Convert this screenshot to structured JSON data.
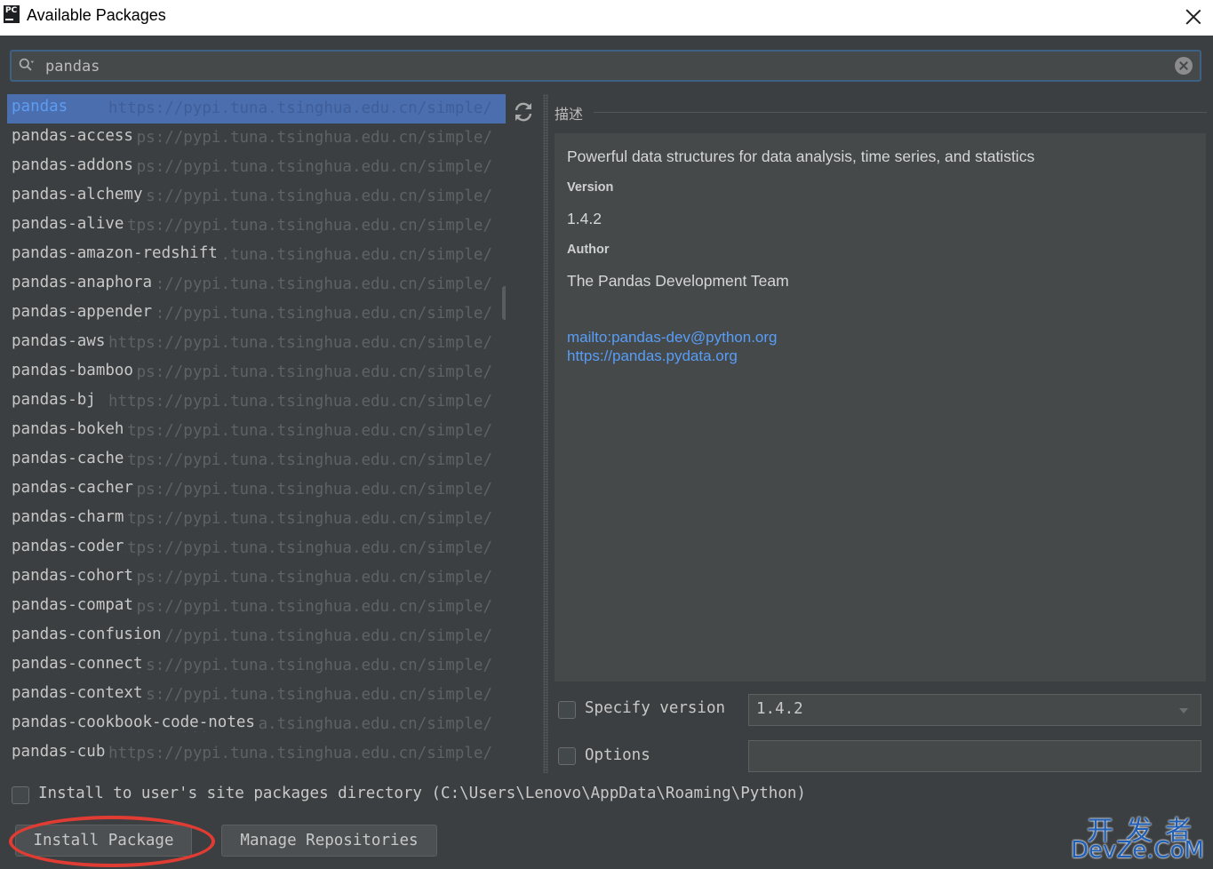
{
  "window": {
    "title": "Available Packages",
    "app_icon_text": "PC"
  },
  "search": {
    "value": "pandas",
    "placeholder": ""
  },
  "packages": [
    {
      "name": "pandas",
      "url": "https://pypi.tuna.tsinghua.edu.cn/simple/",
      "selected": true
    },
    {
      "name": "pandas-access",
      "url": "https://pypi.tuna.tsinghua.edu.cn/simple/"
    },
    {
      "name": "pandas-addons",
      "url": "https://pypi.tuna.tsinghua.edu.cn/simple/"
    },
    {
      "name": "pandas-alchemy",
      "url": "https://pypi.tuna.tsinghua.edu.cn/simple/"
    },
    {
      "name": "pandas-alive",
      "url": "https://pypi.tuna.tsinghua.edu.cn/simple/"
    },
    {
      "name": "pandas-amazon-redshift",
      "url": "https://pypi.tuna.tsinghua.edu.cn/simple/"
    },
    {
      "name": "pandas-anaphora",
      "url": "https://pypi.tuna.tsinghua.edu.cn/simple/"
    },
    {
      "name": "pandas-appender",
      "url": "https://pypi.tuna.tsinghua.edu.cn/simple/"
    },
    {
      "name": "pandas-aws",
      "url": "https://pypi.tuna.tsinghua.edu.cn/simple/"
    },
    {
      "name": "pandas-bamboo",
      "url": "https://pypi.tuna.tsinghua.edu.cn/simple/"
    },
    {
      "name": "pandas-bj",
      "url": "https://pypi.tuna.tsinghua.edu.cn/simple/"
    },
    {
      "name": "pandas-bokeh",
      "url": "https://pypi.tuna.tsinghua.edu.cn/simple/"
    },
    {
      "name": "pandas-cache",
      "url": "https://pypi.tuna.tsinghua.edu.cn/simple/"
    },
    {
      "name": "pandas-cacher",
      "url": "https://pypi.tuna.tsinghua.edu.cn/simple/"
    },
    {
      "name": "pandas-charm",
      "url": "https://pypi.tuna.tsinghua.edu.cn/simple/"
    },
    {
      "name": "pandas-coder",
      "url": "https://pypi.tuna.tsinghua.edu.cn/simple/"
    },
    {
      "name": "pandas-cohort",
      "url": "https://pypi.tuna.tsinghua.edu.cn/simple/"
    },
    {
      "name": "pandas-compat",
      "url": "https://pypi.tuna.tsinghua.edu.cn/simple/"
    },
    {
      "name": "pandas-confusion",
      "url": "https://pypi.tuna.tsinghua.edu.cn/simple/"
    },
    {
      "name": "pandas-connect",
      "url": "https://pypi.tuna.tsinghua.edu.cn/simple/"
    },
    {
      "name": "pandas-context",
      "url": "https://pypi.tuna.tsinghua.edu.cn/simple/"
    },
    {
      "name": "pandas-cookbook-code-notes",
      "url": "https://pypi.tuna.tsinghua.edu.cn/simple/"
    },
    {
      "name": "pandas-cub",
      "url": "https://pypi.tuna.tsinghua.edu.cn/simple/"
    }
  ],
  "description": {
    "section_label": "描述",
    "summary": "Powerful data structures for data analysis, time series, and statistics",
    "version_label": "Version",
    "version_value": "1.4.2",
    "author_label": "Author",
    "author_value": "The Pandas Development Team",
    "links": [
      "mailto:pandas-dev@python.org",
      "https://pandas.pydata.org"
    ]
  },
  "specify_version": {
    "label": "Specify version",
    "value": "1.4.2",
    "checked": false
  },
  "options": {
    "label": "Options",
    "value": "",
    "checked": false
  },
  "install_user": {
    "label": "Install to user's site packages directory (C:\\Users\\Lenovo\\AppData\\Roaming\\Python)",
    "checked": false
  },
  "buttons": {
    "install": "Install Package",
    "manage": "Manage Repositories"
  },
  "watermark": {
    "top": "开发者",
    "bottom": "DevZe.CoM"
  },
  "colors": {
    "background": "#3c3f41",
    "selection": "#4b6eaf",
    "link": "#589df6",
    "annotation": "#e03c33"
  }
}
